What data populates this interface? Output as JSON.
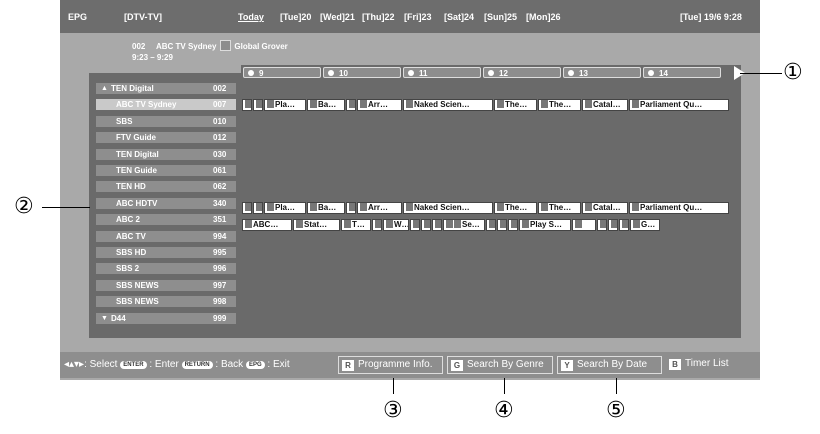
{
  "header": {
    "epg_label": "EPG",
    "mode": "[DTV-TV]",
    "today": "Today",
    "days": [
      "[Tue]20",
      "[Wed]21",
      "[Thu]22",
      "[Fri]23",
      "[Sat]24",
      "[Sun]25",
      "[Mon]26"
    ],
    "datetime": "[Tue] 19/6 9:28"
  },
  "info": {
    "channel_no": "002",
    "channel_name": "ABC TV Sydney",
    "programme": "Global Grover",
    "time": "9:23 – 9:29"
  },
  "timeline": [
    "9",
    "10",
    "11",
    "12",
    "13",
    "14"
  ],
  "channels": [
    {
      "name": "TEN Digital",
      "num": "002"
    },
    {
      "name": "ABC TV Sydney",
      "num": "007"
    },
    {
      "name": "SBS",
      "num": "010"
    },
    {
      "name": "FTV Guide",
      "num": "012"
    },
    {
      "name": "TEN Digital",
      "num": "030"
    },
    {
      "name": "TEN Guide",
      "num": "061"
    },
    {
      "name": "TEN HD",
      "num": "062"
    },
    {
      "name": "ABC HDTV",
      "num": "340"
    },
    {
      "name": "ABC 2",
      "num": "351"
    },
    {
      "name": "ABC TV",
      "num": "994"
    },
    {
      "name": "SBS HD",
      "num": "995"
    },
    {
      "name": "SBS 2",
      "num": "996"
    },
    {
      "name": "SBS NEWS",
      "num": "997"
    },
    {
      "name": "SBS NEWS",
      "num": "998"
    },
    {
      "name": "D44",
      "num": "999"
    }
  ],
  "programmes": {
    "abc_tv_sydney": [
      "",
      "",
      "Pla…",
      "Ba…",
      "",
      "Arr…",
      "Naked Scien…",
      "The…",
      "The…",
      "Catal…",
      "Parliament Qu…"
    ],
    "abc_hdtv": [
      "",
      "",
      "Pla…",
      "Ba…",
      "",
      "Arr…",
      "Naked Scien…",
      "The…",
      "The…",
      "Catal…",
      "Parliament Qu…"
    ],
    "abc2": [
      "ABC…",
      "Stat…",
      "T…",
      "",
      "W…",
      "",
      "",
      "",
      "Se…",
      "",
      "",
      "",
      "Play S…",
      "",
      "",
      "",
      "",
      "G…"
    ]
  },
  "bottom": {
    "select": "Select",
    "enter_pill": "ENTER",
    "enter": "Enter",
    "return_pill": "RETURN",
    "back": "Back",
    "epg_pill": "EPG",
    "exit": "Exit",
    "buttons": [
      {
        "key": "R",
        "label": "Programme Info."
      },
      {
        "key": "G",
        "label": "Search By Genre"
      },
      {
        "key": "Y",
        "label": "Search By Date"
      },
      {
        "key": "B",
        "label": "Timer List"
      }
    ]
  },
  "callouts": [
    "①",
    "②",
    "③",
    "④",
    "⑤"
  ]
}
